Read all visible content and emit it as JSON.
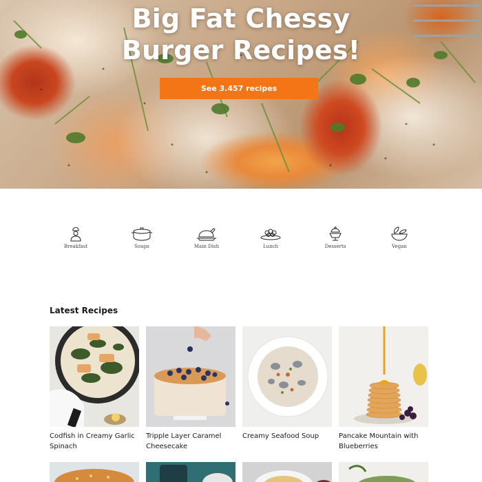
{
  "hero": {
    "title_line1": "Big Fat Chessy",
    "title_line2": "Burger Recipes!",
    "cta_label": "See 3.457 recipes"
  },
  "categories": [
    {
      "label": "Breakfast",
      "icon": "chef-icon"
    },
    {
      "label": "Soups",
      "icon": "pot-icon"
    },
    {
      "label": "Main Dish",
      "icon": "roast-chicken-icon"
    },
    {
      "label": "Lunch",
      "icon": "platter-icon"
    },
    {
      "label": "Desserts",
      "icon": "dessert-icon"
    },
    {
      "label": "Vegan",
      "icon": "salad-bowl-icon"
    }
  ],
  "latest": {
    "heading": "Latest Recipes",
    "recipes": [
      {
        "title": "Codfish in Creamy Garlic Spinach"
      },
      {
        "title": "Tripple Layer Caramel Cheesecake"
      },
      {
        "title": "Creamy Seafood Soup"
      },
      {
        "title": "Pancake Mountain with Blueberries"
      }
    ]
  },
  "colors": {
    "accent": "#f47516",
    "hero_text": "#ffffff",
    "text": "#1a1a1a"
  }
}
